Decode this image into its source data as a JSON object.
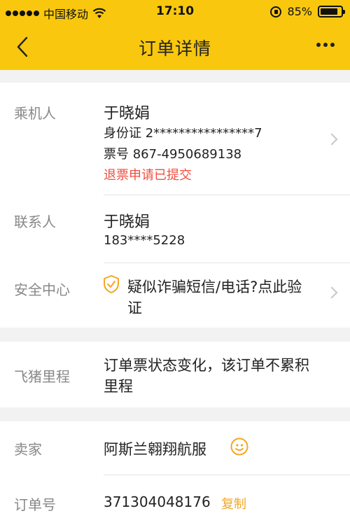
{
  "status": {
    "carrier": "中国移动",
    "time": "17:10",
    "battery": "85%",
    "battery_level": 0.85
  },
  "nav": {
    "title": "订单详情"
  },
  "passenger": {
    "label": "乘机人",
    "name": "于晓娟",
    "id_line": "身份证 2****************7",
    "ticket_line": "票号 867-4950689138",
    "status": "退票申请已提交"
  },
  "contact": {
    "label": "联系人",
    "name": "于晓娟",
    "phone": "183****5228"
  },
  "security": {
    "label": "安全中心",
    "text_line1": "疑似诈骗短信/电话?点此验",
    "text_line2": "证"
  },
  "mileage": {
    "label": "飞猪里程",
    "text_line1": "订单票状态变化，该订单不累积",
    "text_line2": "里程"
  },
  "seller": {
    "label": "卖家",
    "name": "阿斯兰翱翔航服"
  },
  "order": {
    "label": "订单号",
    "number": "371304048176",
    "copy_label": "复制"
  },
  "colors": {
    "brand": "#f9c80e",
    "alert": "#f04e3e",
    "accent": "#f5a623"
  }
}
